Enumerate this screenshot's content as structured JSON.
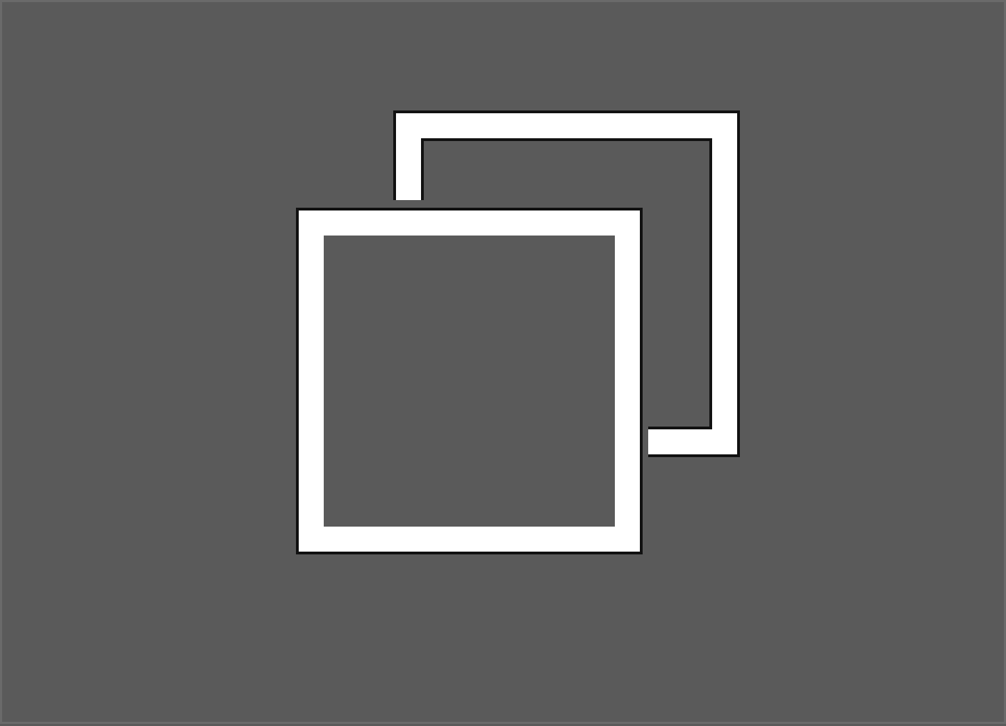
{
  "window_control": {
    "icon": "restore-window-icon",
    "colors": {
      "background": "#5a5a5a",
      "border": "#6a6a6a",
      "icon_stroke": "#ffffff",
      "icon_outline": "#111111"
    }
  }
}
